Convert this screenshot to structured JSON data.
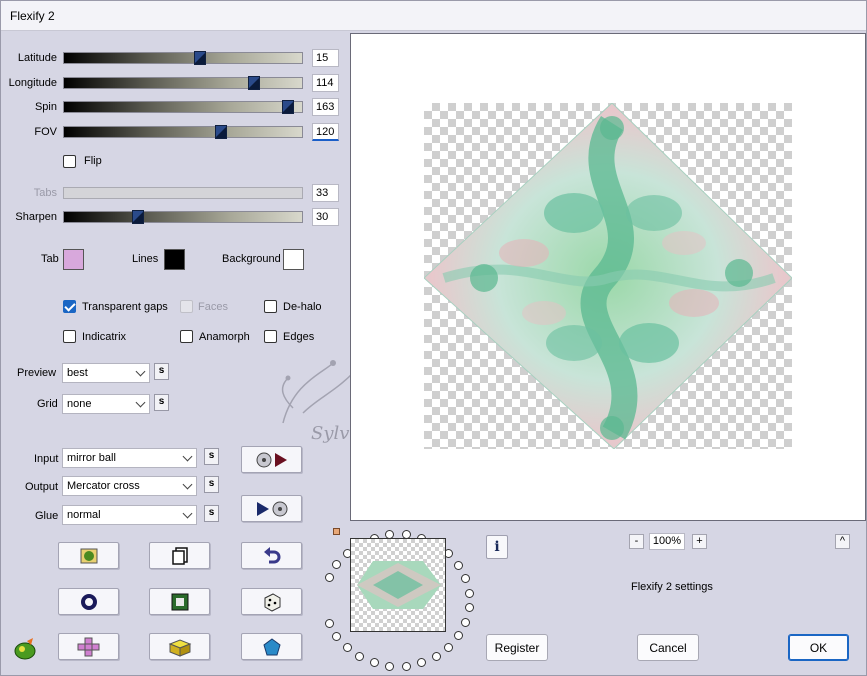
{
  "window": {
    "title": "Flexify 2"
  },
  "sliders": [
    {
      "label": "Latitude",
      "value": "15",
      "fraction": 0.57,
      "disabled": false
    },
    {
      "label": "Longitude",
      "value": "114",
      "fraction": 0.8,
      "disabled": false
    },
    {
      "label": "Spin",
      "value": "163",
      "fraction": 0.94,
      "disabled": false
    },
    {
      "label": "FOV",
      "value": "120",
      "fraction": 0.66,
      "disabled": false
    },
    {
      "label": "Tabs",
      "value": "33",
      "fraction": 0.0,
      "disabled": true
    },
    {
      "label": "Sharpen",
      "value": "30",
      "fraction": 0.31,
      "disabled": false
    }
  ],
  "flip": {
    "label": "Flip",
    "checked": false
  },
  "colors": {
    "tab": {
      "label": "Tab",
      "color": "#d8a8dc"
    },
    "lines": {
      "label": "Lines",
      "color": "#000000"
    },
    "background": {
      "label": "Background",
      "color": "#ffffff"
    }
  },
  "options": {
    "transparent_gaps": {
      "label": "Transparent gaps",
      "checked": true
    },
    "faces": {
      "label": "Faces",
      "checked": false,
      "disabled": true
    },
    "de_halo": {
      "label": "De-halo",
      "checked": false
    },
    "indicatrix": {
      "label": "Indicatrix",
      "checked": false
    },
    "anamorph": {
      "label": "Anamorph",
      "checked": false
    },
    "edges": {
      "label": "Edges",
      "checked": false
    }
  },
  "preview": {
    "label": "Preview",
    "value": "best"
  },
  "grid": {
    "label": "Grid",
    "value": "none"
  },
  "input": {
    "label": "Input",
    "value": "mirror ball"
  },
  "output": {
    "label": "Output",
    "value": "Mercator cross"
  },
  "glue": {
    "label": "Glue",
    "value": "normal"
  },
  "s_button": "s",
  "zoom": {
    "minus": "-",
    "value": "100%",
    "plus": "+"
  },
  "settings_text": "Flexify 2 settings",
  "info_label": "i",
  "up_label": "^",
  "buttons": {
    "register": "Register",
    "cancel": "Cancel",
    "ok": "OK"
  },
  "watermark_text": "Sylviane",
  "accent": "#1a66c4"
}
